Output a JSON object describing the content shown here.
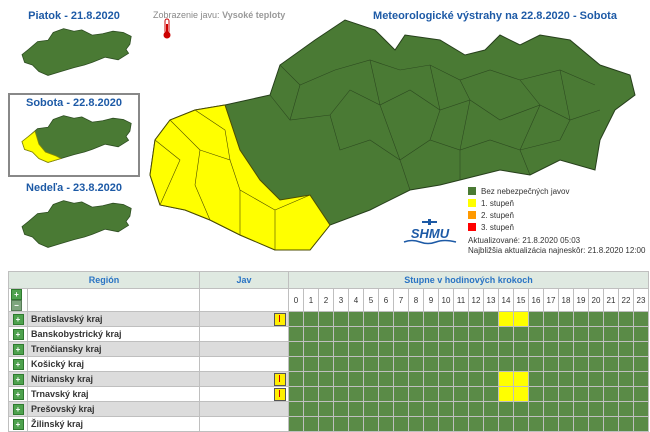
{
  "days": [
    {
      "label": "Piatok - 21.8.2020",
      "active": false
    },
    {
      "label": "Sobota - 22.8.2020",
      "active": true
    },
    {
      "label": "Nedeľa - 23.8.2020",
      "active": false
    }
  ],
  "phenomenon": {
    "prefix": "Zobrazenie javu:",
    "value": "Vysoké teploty"
  },
  "main_title": "Meteorologické výstrahy na 22.8.2020 - Sobota",
  "legend": [
    {
      "label": "Bez nebezpečných javov",
      "color": "#4a7a34"
    },
    {
      "label": "1. stupeň",
      "color": "#ffff00"
    },
    {
      "label": "2. stupeň",
      "color": "#ff9900"
    },
    {
      "label": "3. stupeň",
      "color": "#ff0000"
    }
  ],
  "logo_text": "SHMU",
  "updated": "Aktualizované: 21.8.2020 05:03",
  "next_update": "Najbližšia aktualizácia najneskôr: 21.8.2020 12:00",
  "table": {
    "headers": {
      "region": "Región",
      "jav": "Jav",
      "steps": "Stupne v hodinových krokoch"
    },
    "hours": [
      "0",
      "1",
      "2",
      "3",
      "4",
      "5",
      "6",
      "7",
      "8",
      "9",
      "10",
      "11",
      "12",
      "13",
      "14",
      "15",
      "16",
      "17",
      "18",
      "19",
      "20",
      "21",
      "22",
      "23"
    ],
    "rows": [
      {
        "name": "Bratislavský kraj",
        "icon": true,
        "warn_hours": [
          14,
          15
        ]
      },
      {
        "name": "Banskobystrický kraj",
        "icon": false,
        "warn_hours": []
      },
      {
        "name": "Trenčiansky kraj",
        "icon": false,
        "warn_hours": []
      },
      {
        "name": "Košický kraj",
        "icon": false,
        "warn_hours": []
      },
      {
        "name": "Nitriansky kraj",
        "icon": true,
        "warn_hours": [
          14,
          15
        ]
      },
      {
        "name": "Trnavský kraj",
        "icon": true,
        "warn_hours": [
          14,
          15
        ]
      },
      {
        "name": "Prešovský kraj",
        "icon": false,
        "warn_hours": []
      },
      {
        "name": "Žilinský kraj",
        "icon": false,
        "warn_hours": []
      }
    ]
  },
  "colors": {
    "safe": "#5a8b47",
    "warn1": "#ffff00",
    "map_green": "#4a7a34",
    "map_yellow": "#ffff00",
    "title_blue": "#1d5aa6"
  }
}
